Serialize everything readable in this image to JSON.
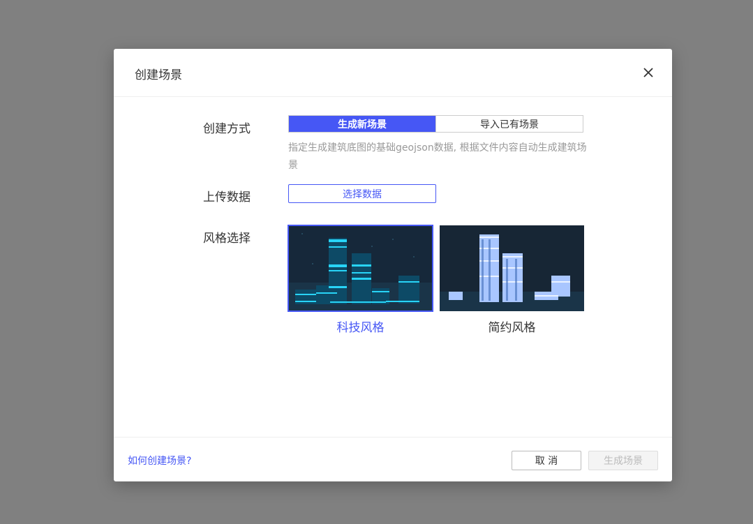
{
  "dialog": {
    "title": "创建场景",
    "close_icon": "close-icon"
  },
  "form": {
    "method_label": "创建方式",
    "method_options": [
      "生成新场景",
      "导入已有场景"
    ],
    "method_selected": "生成新场景",
    "method_hint": "指定生成建筑底图的基础geojson数据, 根据文件内容自动生成建筑场景",
    "upload_label": "上传数据",
    "upload_button": "选择数据",
    "style_label": "风格选择",
    "styles": [
      {
        "name": "科技风格",
        "selected": true
      },
      {
        "name": "简约风格",
        "selected": false
      }
    ]
  },
  "footer": {
    "help_link": "如何创建场景?",
    "cancel": "取 消",
    "create": "生成场景"
  },
  "colors": {
    "accent": "#4657f5",
    "overlay": "#808080"
  }
}
